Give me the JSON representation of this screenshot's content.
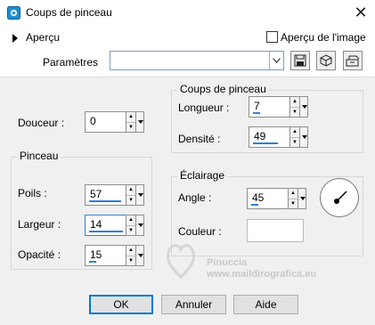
{
  "window": {
    "title": "Coups de pinceau"
  },
  "preview": {
    "toggle_label": "Aperçu",
    "image_preview_label": "Aperçu de l'image"
  },
  "params": {
    "label": "Paramètres",
    "value": ""
  },
  "stroke_group": {
    "title": "Coups de pinceau",
    "length": {
      "label": "Longueur :",
      "value": "7"
    },
    "density": {
      "label": "Densité :",
      "value": "49"
    }
  },
  "softness": {
    "label": "Douceur :",
    "value": "0"
  },
  "brush_group": {
    "title": "Pinceau",
    "bristles": {
      "label": "Poils :",
      "value": "57"
    },
    "width": {
      "label": "Largeur :",
      "value": "14"
    },
    "opacity": {
      "label": "Opacité :",
      "value": "15"
    }
  },
  "lighting_group": {
    "title": "Éclairage",
    "angle": {
      "label": "Angle :",
      "value": "45"
    },
    "color": {
      "label": "Couleur :",
      "value": "#ffffff"
    }
  },
  "buttons": {
    "ok": "OK",
    "cancel": "Annuler",
    "help": "Aide"
  },
  "watermark": {
    "name": "Pinuccia",
    "url": "www.maildirografica.eu"
  }
}
